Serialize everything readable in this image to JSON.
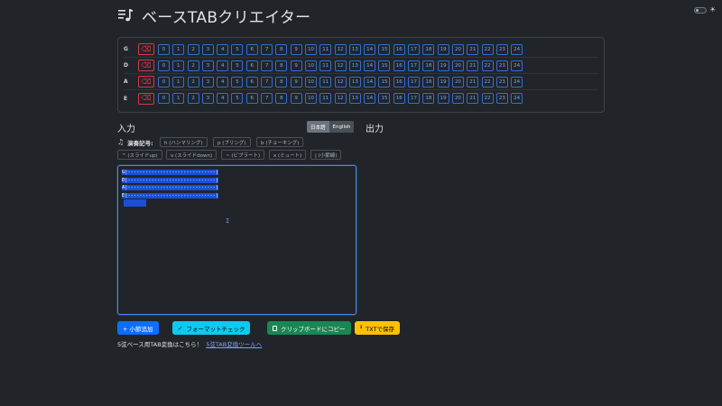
{
  "header": {
    "title": "ベースTABクリエイター",
    "icon": "music-list-icon"
  },
  "theme": {
    "icon": "sun-icon"
  },
  "fretboard": {
    "strings": [
      "G",
      "D",
      "A",
      "E"
    ],
    "clear_icon": "⌫",
    "frets": [
      "0",
      "1",
      "2",
      "3",
      "4",
      "5",
      "6",
      "7",
      "8",
      "9",
      "10",
      "11",
      "12",
      "13",
      "14",
      "15",
      "16",
      "17",
      "18",
      "19",
      "20",
      "21",
      "22",
      "23",
      "24"
    ]
  },
  "input_label": "入力",
  "output_label": "出力",
  "language": {
    "options": [
      "日本語",
      "English"
    ],
    "selected": "日本語"
  },
  "notation": {
    "label": "演奏記号:",
    "chips": [
      "h (ハンマリング)",
      "p (プリング)",
      "b (チョーキング)",
      "^ (スライドup)",
      "v (スライドdown)",
      "~ (ビブラート)",
      "x (ミュート)",
      "| (小節線)"
    ]
  },
  "editor": {
    "lines": [
      "G|------------------------------|",
      "D|------------------------------|",
      "A|------------------------------|",
      "E|------------------------------|"
    ]
  },
  "actions": {
    "add_measure": "+ 小節追加",
    "format_check": "フォーマットチェック",
    "copy_clipboard": "クリップボードにコピー",
    "save_txt": "TXTで保存"
  },
  "footer": {
    "text": "5弦ベース用TAB変換はこちら！",
    "link": "5弦TAB変換ツールへ"
  },
  "colors": {
    "background": "#212529",
    "primary": "#0d6efd",
    "info": "#0dcaf0",
    "success": "#198754",
    "warning": "#ffc107",
    "danger": "#dc3545"
  }
}
